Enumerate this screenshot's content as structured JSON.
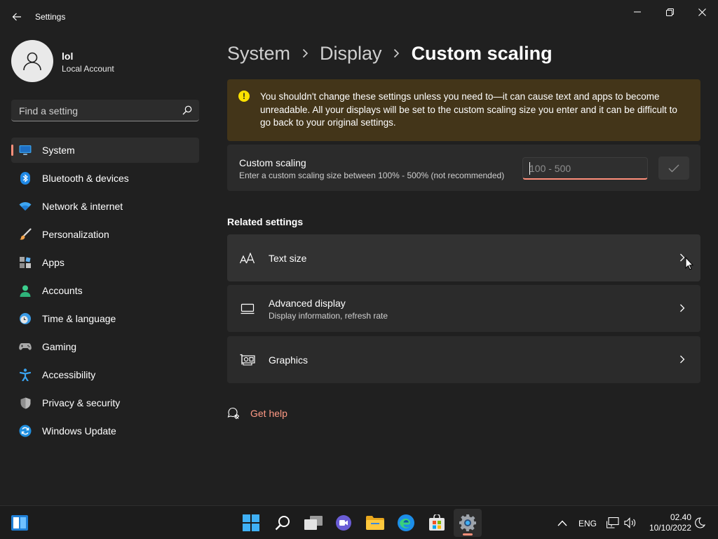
{
  "window": {
    "title": "Settings"
  },
  "user": {
    "name": "lol",
    "account_type": "Local Account"
  },
  "search": {
    "placeholder": "Find a setting"
  },
  "nav": {
    "items": [
      {
        "label": "System",
        "icon": "monitor-icon",
        "active": true
      },
      {
        "label": "Bluetooth & devices",
        "icon": "bluetooth-icon"
      },
      {
        "label": "Network & internet",
        "icon": "wifi-icon"
      },
      {
        "label": "Personalization",
        "icon": "brush-icon"
      },
      {
        "label": "Apps",
        "icon": "apps-icon"
      },
      {
        "label": "Accounts",
        "icon": "person-icon"
      },
      {
        "label": "Time & language",
        "icon": "clock-globe-icon"
      },
      {
        "label": "Gaming",
        "icon": "gamepad-icon"
      },
      {
        "label": "Accessibility",
        "icon": "accessibility-icon"
      },
      {
        "label": "Privacy & security",
        "icon": "shield-icon"
      },
      {
        "label": "Windows Update",
        "icon": "update-icon"
      }
    ]
  },
  "breadcrumb": {
    "items": [
      "System",
      "Display",
      "Custom scaling"
    ]
  },
  "warning": {
    "text": "You shouldn't change these settings unless you need to—it can cause text and apps to become unreadable. All your displays will be set to the custom scaling size you enter and it can be difficult to go back to your original settings."
  },
  "custom_scaling": {
    "title": "Custom scaling",
    "description": "Enter a custom scaling size between 100% - 500% (not recommended)",
    "input_placeholder": "100 - 500",
    "input_value": ""
  },
  "related": {
    "title": "Related settings",
    "items": [
      {
        "title": "Text size",
        "subtitle": "",
        "icon": "text-size-icon"
      },
      {
        "title": "Advanced display",
        "subtitle": "Display information, refresh rate",
        "icon": "monitor-icon"
      },
      {
        "title": "Graphics",
        "subtitle": "",
        "icon": "graphics-card-icon"
      }
    ]
  },
  "help": {
    "label": "Get help"
  },
  "taskbar": {
    "language": "ENG",
    "time": "02.40",
    "date": "10/10/2022"
  },
  "colors": {
    "accent": "#ff8f7a",
    "background": "#202020",
    "card": "#2b2b2b",
    "warning_bg": "#433519",
    "warning_icon": "#fce100"
  }
}
